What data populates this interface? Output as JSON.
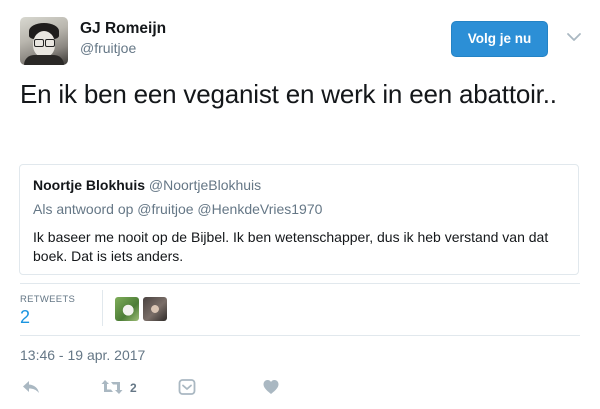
{
  "user": {
    "name": "GJ Romeijn",
    "handle": "@fruitjoe"
  },
  "follow_button": "Volg je nu",
  "tweet": {
    "text": "En ik ben een veganist en werk in een abattoir.."
  },
  "quoted": {
    "name": "Noortje Blokhuis",
    "handle": "@NoortjeBlokhuis",
    "reply_prefix": "Als antwoord op",
    "reply_to_1": "@fruitjoe",
    "reply_to_2": "@HenkdeVries1970",
    "body": "Ik baseer me nooit op de Bijbel. Ik ben wetenschapper, dus ik heb verstand van dat boek. Dat is iets anders."
  },
  "stats": {
    "retweets_label": "RETWEETS",
    "retweets_count": "2"
  },
  "timestamp": "13:46 - 19 apr. 2017",
  "actions": {
    "retweet_count": "2"
  },
  "icons": [
    "reply-icon",
    "retweet-icon",
    "dm-icon",
    "like-icon",
    "chevron-down-icon"
  ],
  "colors": {
    "follow_bg": "#2c8fd6",
    "link_blue": "#1b95e0",
    "muted": "#657786",
    "border": "#e1e8ed",
    "icon_gray": "#aab8c2"
  }
}
